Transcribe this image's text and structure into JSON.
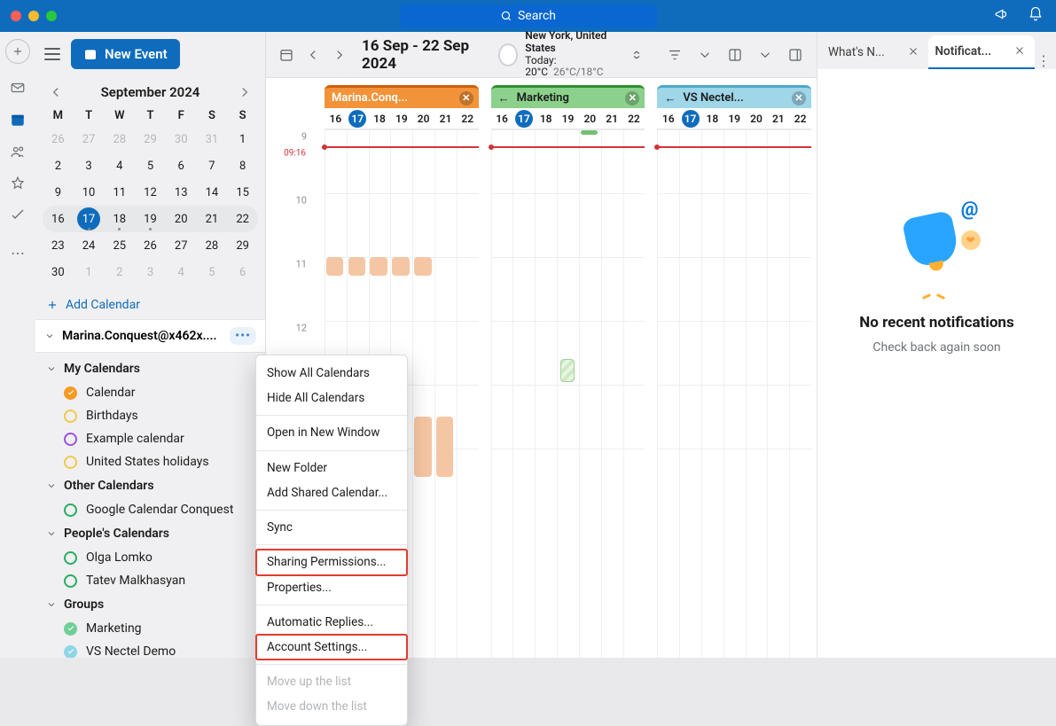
{
  "title_search_placeholder": "Search",
  "new_event": "New Event",
  "mini": {
    "title": "September 2024",
    "dow": [
      "M",
      "T",
      "W",
      "T",
      "F",
      "S",
      "S"
    ],
    "rows": [
      [
        {
          "d": "26",
          "dim": true
        },
        {
          "d": "27",
          "dim": true
        },
        {
          "d": "28",
          "dim": true
        },
        {
          "d": "29",
          "dim": true
        },
        {
          "d": "30",
          "dim": true
        },
        {
          "d": "31",
          "dim": true
        },
        {
          "d": "1"
        }
      ],
      [
        {
          "d": "2"
        },
        {
          "d": "3"
        },
        {
          "d": "4"
        },
        {
          "d": "5"
        },
        {
          "d": "6"
        },
        {
          "d": "7"
        },
        {
          "d": "8"
        }
      ],
      [
        {
          "d": "9"
        },
        {
          "d": "10"
        },
        {
          "d": "11"
        },
        {
          "d": "12"
        },
        {
          "d": "13"
        },
        {
          "d": "14"
        },
        {
          "d": "15"
        }
      ],
      [
        {
          "d": "16",
          "wk": true
        },
        {
          "d": "17",
          "wk": true,
          "today": true,
          "dot": true
        },
        {
          "d": "18",
          "wk": true,
          "dot": true
        },
        {
          "d": "19",
          "wk": true,
          "dot": true
        },
        {
          "d": "20",
          "wk": true
        },
        {
          "d": "21",
          "wk": true
        },
        {
          "d": "22",
          "wk": true
        }
      ],
      [
        {
          "d": "23"
        },
        {
          "d": "24"
        },
        {
          "d": "25"
        },
        {
          "d": "26"
        },
        {
          "d": "27"
        },
        {
          "d": "28"
        },
        {
          "d": "29"
        }
      ],
      [
        {
          "d": "30"
        },
        {
          "d": "1",
          "dim": true
        },
        {
          "d": "2",
          "dim": true
        },
        {
          "d": "3",
          "dim": true
        },
        {
          "d": "4",
          "dim": true
        },
        {
          "d": "5",
          "dim": true
        },
        {
          "d": "6",
          "dim": true
        }
      ]
    ]
  },
  "add_calendar": "Add Calendar",
  "account_label": "Marina.Conquest@x462x....",
  "tree": {
    "g1": "My Calendars",
    "i1": "Calendar",
    "i2": "Birthdays",
    "i3": "Example calendar",
    "i4": "United States holidays",
    "g2": "Other Calendars",
    "i5": "Google Calendar Conquest",
    "g3": "People's Calendars",
    "i6": "Olga Lomko",
    "i7": "Tatev Malkhasyan",
    "g4": "Groups",
    "i8": "Marketing",
    "i9": "VS Nectel Demo"
  },
  "toolbar_range": "16 Sep - 22 Sep 2024",
  "weather": {
    "loc": "New York, United States",
    "now": "Today: 20°C",
    "hilo": "26°C/18°C"
  },
  "columns": [
    {
      "label": "Marina.Conq...",
      "bg": "#f2933a",
      "border": "#d05f0a",
      "text": "#fff"
    },
    {
      "label": "Marketing",
      "bg": "#8bd18b",
      "border": "#2f8f2f",
      "text": "#1b1b1b"
    },
    {
      "label": "VS Nectel...",
      "bg": "#9fd6e8",
      "border": "#4ea8c6",
      "text": "#1b1b1b"
    }
  ],
  "days": [
    "16",
    "17",
    "18",
    "19",
    "20",
    "21",
    "22"
  ],
  "today_index": 1,
  "hours": [
    "9",
    "10",
    "11",
    "12"
  ],
  "now_label": "09:16",
  "ctx": {
    "show_all": "Show All Calendars",
    "hide_all": "Hide All Calendars",
    "open_new": "Open in New Window",
    "new_folder": "New Folder",
    "add_shared": "Add Shared Calendar...",
    "sync": "Sync",
    "sharing": "Sharing Permissions...",
    "properties": "Properties...",
    "auto": "Automatic Replies...",
    "settings": "Account Settings...",
    "moveup": "Move up the list",
    "movedown": "Move down the list"
  },
  "tabs": {
    "t1": "What's N...",
    "t2": "Notificat..."
  },
  "right": {
    "title": "No recent notifications",
    "sub": "Check back again soon"
  }
}
